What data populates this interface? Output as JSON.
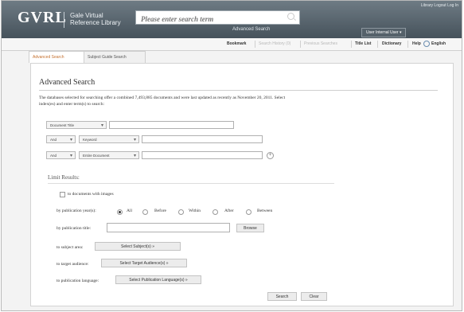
{
  "header": {
    "logo": "GVRL",
    "logo_sub_1": "Gale Virtual",
    "logo_sub_2": "Reference Library",
    "search_placeholder": "Please enter search term",
    "advanced_search_link": "Advanced Search",
    "user_button": "User Internal User",
    "top_links": "Library   Logout   Log In"
  },
  "toolbar": {
    "bookmark": "Bookmark",
    "search_history": "Search History (0)",
    "previous_searches": "Previous Searches",
    "title_list": "Title List",
    "dictionary": "Dictionary",
    "help": "Help",
    "language": "English"
  },
  "tabs": [
    {
      "label": "Advanced Search",
      "active": true
    },
    {
      "label": "Subject Guide Search",
      "active": false
    }
  ],
  "main": {
    "heading": "Advanced Search",
    "description": "The databases selected for searching offer a combined 7,493,885 documents and were last updated as recently as November 20, 2011. Select index(es) and enter term(s) to search:"
  },
  "search_rows": [
    {
      "field": "Document Title"
    },
    {
      "operator": "And",
      "field": "Keyword"
    },
    {
      "operator": "And",
      "field": "Entire Document"
    }
  ],
  "limits": {
    "heading": "Limit Results:",
    "images_label": "to documents with images",
    "year_label": "by publication year(s):",
    "year_options": [
      "All",
      "Before",
      "Within",
      "After",
      "Between"
    ],
    "year_selected": "All",
    "title_label": "by publication title:",
    "browse_button": "Browse",
    "subject_label": "to subject area:",
    "subject_button": "Select Subject(s) »",
    "audience_label": "to target audience:",
    "audience_button": "Select Target Audience(s) »",
    "language_label": "to publication language:",
    "language_button": "Select Publication Language(s) »"
  },
  "actions": {
    "search": "Search",
    "clear": "Clear"
  },
  "colors": {
    "header_bg": "#55616a",
    "active_tab": "#c4702e"
  }
}
